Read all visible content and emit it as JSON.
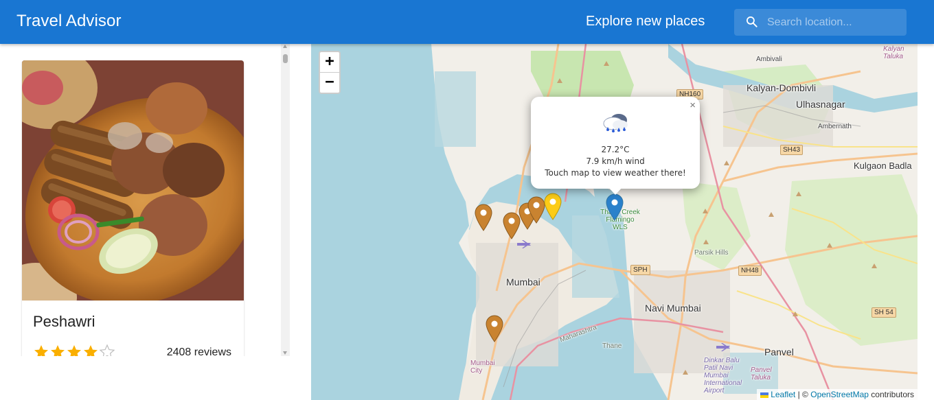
{
  "app": {
    "title": "Travel Advisor",
    "tagline": "Explore new places",
    "search_placeholder": "Search location...",
    "search_value": "",
    "colors": {
      "appbar": "#1976d2",
      "star": "#faaf00",
      "pin_restaurant": "#c98330",
      "pin_selected": "#fccc17",
      "pin_user": "#2a81cb"
    }
  },
  "list": {
    "places": [
      {
        "name": "Peshawri",
        "rating": 4.5,
        "reviews": "2408 reviews",
        "image_icon": "food-photo"
      }
    ]
  },
  "map": {
    "zoom_in": "+",
    "zoom_out": "−",
    "labels": {
      "mumbai": "Mumbai",
      "navi_mumbai": "Navi Mumbai",
      "kalyan": "Kalyan-Dombivli",
      "ulhasnagar": "Ulhasnagar",
      "kulgaon": "Kulgaon Badla",
      "panvel": "Panvel",
      "ambivali": "Ambivali",
      "ambernath": "Ambernath",
      "parsik": "Parsik Hills",
      "thane_creek": "Thane Creek Flamingo WLS",
      "maharashtra": "Maharashtra",
      "thane": "Thane",
      "mumbai_city": "Mumbai City",
      "kalyan_taluka": "Kalyan Taluka",
      "panvel_taluka": "Panvel Taluka",
      "airport": "Dinkar Balu Patil Navi Mumbai International Airport"
    },
    "roads": [
      "NH160",
      "SH43",
      "SPH",
      "NH48",
      "SH 54"
    ],
    "popup": {
      "weather_icon": "rain-cloud-icon",
      "temperature": "27.2°C",
      "wind": "7.9 km/h wind",
      "hint": "Touch map to view weather there!",
      "close": "×"
    },
    "attribution": {
      "leaflet": "Leaflet",
      "sep": "|",
      "copy": "©",
      "osm": "OpenStreetMap",
      "contrib": "contributors"
    }
  }
}
